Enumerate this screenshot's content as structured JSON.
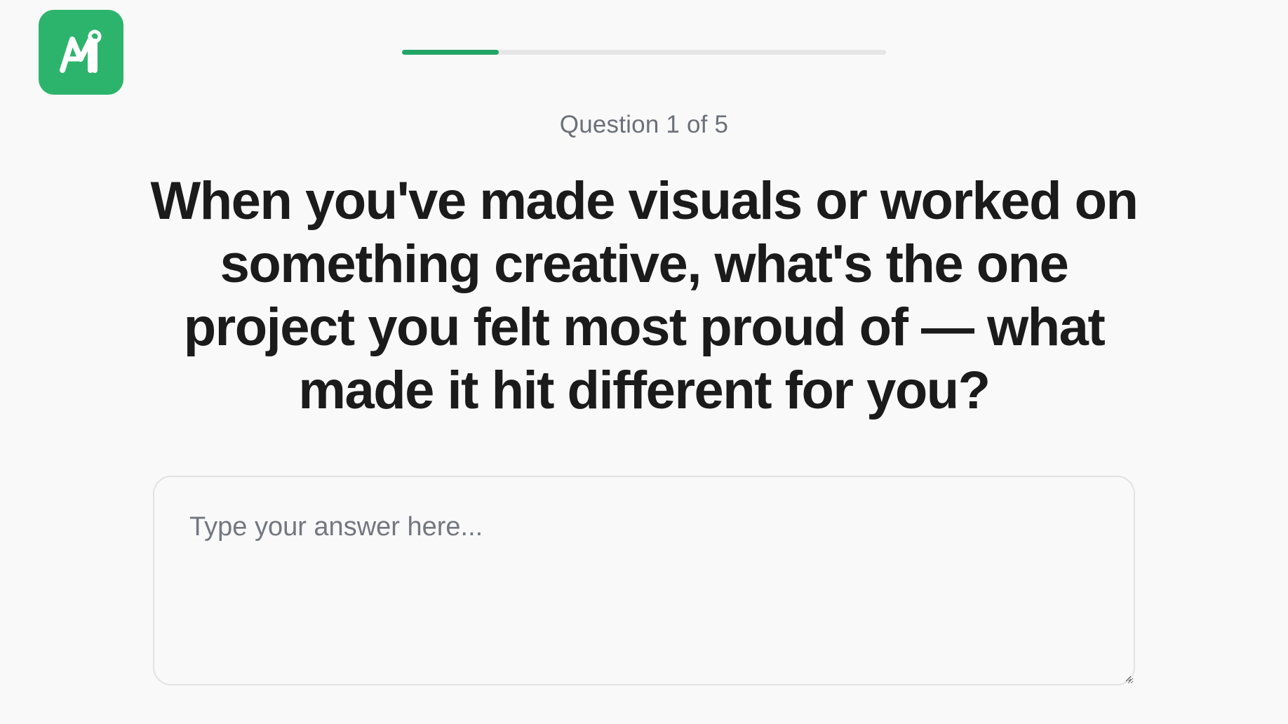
{
  "brand": {
    "logo_icon": "ni-logo-icon",
    "logo_color": "#2db46c"
  },
  "progress": {
    "current": 1,
    "total": 5,
    "fraction": 0.2,
    "fill_color": "#22a565",
    "track_color": "#e6e6e6"
  },
  "question": {
    "counter_text": "Question 1 of 5",
    "text": "When you've made visuals or worked on something creative, what's the one project you felt most proud of — what made it hit different for you?"
  },
  "answer": {
    "value": "",
    "placeholder": "Type your answer here..."
  }
}
